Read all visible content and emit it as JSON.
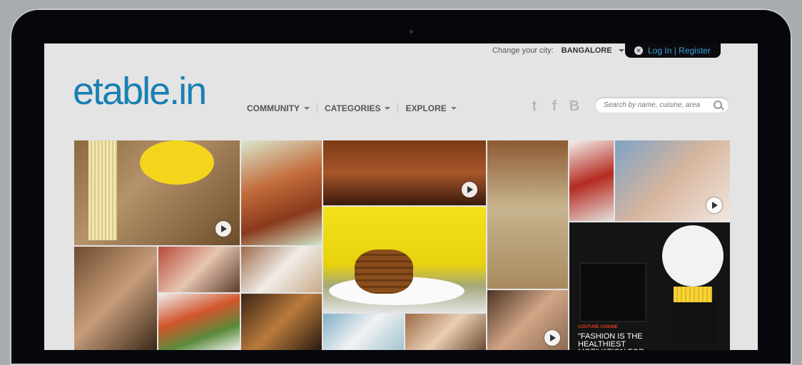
{
  "city": {
    "label": "Change your city:",
    "value": "BANGALORE"
  },
  "auth": {
    "label": "Log In | Register"
  },
  "brand": {
    "logo": "etable.in",
    "color": "#1a7fb3"
  },
  "nav": [
    {
      "label": "COMMUNITY"
    },
    {
      "label": "CATEGORIES"
    },
    {
      "label": "EXPLORE"
    }
  ],
  "social": [
    {
      "icon": "twitter-icon",
      "glyph": "t"
    },
    {
      "icon": "facebook-icon",
      "glyph": "f"
    },
    {
      "icon": "blogger-icon",
      "glyph": "B"
    }
  ],
  "search": {
    "placeholder": "Search by name, cuisine, area"
  },
  "ad": {
    "kicker": "COUTURE CUISINE",
    "text": "\"FASHION IS THE HEALTHIEST MOTIVATION FOR LOSING"
  }
}
